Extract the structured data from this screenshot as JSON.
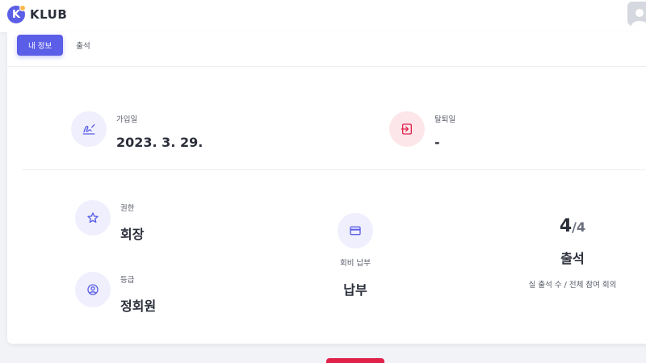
{
  "header": {
    "logo_letter": "K",
    "app_name": "KLUB"
  },
  "tabs": [
    {
      "label": "내 정보",
      "active": true
    },
    {
      "label": "출석",
      "active": false
    }
  ],
  "membership": {
    "join_label": "가입일",
    "join_value": "2023. 3. 29.",
    "leave_label": "탈퇴일",
    "leave_value": "-"
  },
  "role": {
    "label": "권한",
    "value": "회장"
  },
  "grade": {
    "label": "등급",
    "value": "정회원"
  },
  "fee": {
    "label": "회비 납부",
    "value": "납부"
  },
  "attendance": {
    "attended": "4",
    "separator": "/",
    "total": "4",
    "title": "출석",
    "subtitle": "실 출석 수 / 전체 참여 회의"
  },
  "colors": {
    "accent": "#5b5ee6",
    "danger": "#e0224a",
    "icon_bg_purple": "#efeffd",
    "icon_bg_pink": "#fde6ea"
  },
  "icons": {
    "join": "signature-icon",
    "leave": "logout-icon",
    "role": "star-icon",
    "grade": "user-circle-icon",
    "fee": "credit-card-icon",
    "avatar": "user-icon"
  }
}
